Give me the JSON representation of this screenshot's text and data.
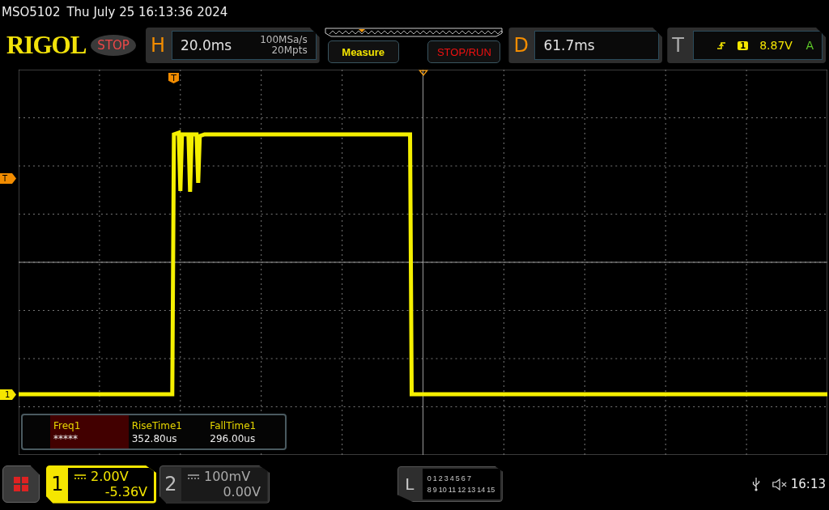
{
  "title_bar": {
    "model": "MSO5102",
    "datetime": "Thu July 25 16:13:36 2024"
  },
  "logo": "RIGOL",
  "run_state": "STOP",
  "horizontal": {
    "label": "H",
    "timebase": "20.0ms",
    "sample_rate": "100MSa/s",
    "memory_depth": "20Mpts"
  },
  "buttons": [
    {
      "label": "Measure",
      "kind": "measure"
    },
    {
      "label": "STOP/RUN",
      "kind": "run"
    }
  ],
  "delay": {
    "label": "D",
    "value": "61.7ms"
  },
  "trigger": {
    "label": "T",
    "channel": "1",
    "level": "8.87V",
    "coupling": "A"
  },
  "markers": {
    "trigger_position": "T",
    "trigger_level": "T",
    "channel": "1"
  },
  "measurements": [
    {
      "name": "Freq1",
      "value": "*****",
      "selected": true
    },
    {
      "name": "RiseTime1",
      "value": "352.80us",
      "selected": false
    },
    {
      "name": "FallTime1",
      "value": "296.00us",
      "selected": false
    }
  ],
  "channels": [
    {
      "number": "1",
      "scale": "2.00V",
      "offset": "-5.36V",
      "selected": true
    },
    {
      "number": "2",
      "scale": "100mV",
      "offset": "0.00V",
      "selected": false
    }
  ],
  "logic": {
    "label": "L",
    "row_1": [
      "0",
      "1",
      "2",
      "3",
      "4",
      "5",
      "6",
      "7"
    ],
    "row_2": [
      "8",
      "9",
      "10",
      "11",
      "12",
      "13",
      "14",
      "15"
    ]
  },
  "status": {
    "clock": "16:13"
  }
}
